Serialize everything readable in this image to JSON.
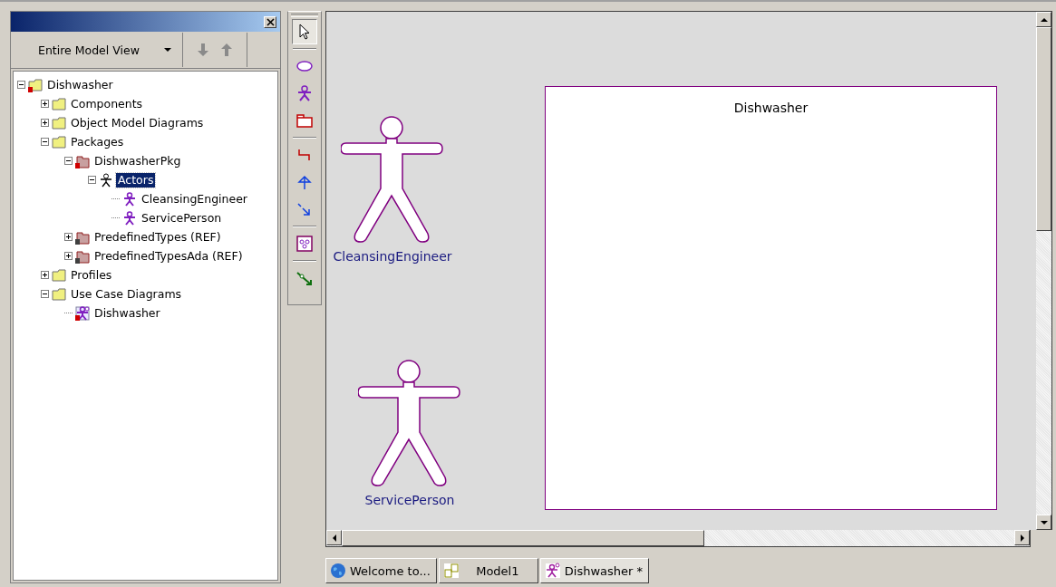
{
  "browser": {
    "view": "Entire Model View",
    "tree": [
      {
        "label": "Dishwasher",
        "kind": "model",
        "expanded": true,
        "selected": false,
        "children": [
          {
            "label": "Components",
            "kind": "folder",
            "expanded": false,
            "selected": false
          },
          {
            "label": "Object Model Diagrams",
            "kind": "folder",
            "expanded": false,
            "selected": false
          },
          {
            "label": "Packages",
            "kind": "folder",
            "expanded": true,
            "selected": false,
            "children": [
              {
                "label": "DishwasherPkg",
                "kind": "package",
                "expanded": true,
                "selected": false,
                "children": [
                  {
                    "label": "Actors",
                    "kind": "actor-group",
                    "expanded": true,
                    "selected": true,
                    "children": [
                      {
                        "label": "CleansingEngineer",
                        "kind": "actor",
                        "selected": false
                      },
                      {
                        "label": "ServicePerson",
                        "kind": "actor",
                        "selected": false
                      }
                    ]
                  }
                ]
              },
              {
                "label": "PredefinedTypes (REF)",
                "kind": "ref-package",
                "expanded": false,
                "selected": false
              },
              {
                "label": "PredefinedTypesAda (REF)",
                "kind": "ref-package",
                "expanded": false,
                "selected": false
              }
            ]
          },
          {
            "label": "Profiles",
            "kind": "folder",
            "expanded": false,
            "selected": false
          },
          {
            "label": "Use Case Diagrams",
            "kind": "folder",
            "expanded": true,
            "selected": false,
            "children": [
              {
                "label": "Dishwasher",
                "kind": "diagram",
                "selected": false
              }
            ]
          }
        ]
      }
    ]
  },
  "tools": [
    [
      {
        "kind": "pointer",
        "selected": true
      }
    ],
    [
      {
        "kind": "usecase",
        "selected": false
      },
      {
        "kind": "actor",
        "selected": false
      },
      {
        "kind": "package",
        "selected": false
      }
    ],
    [
      {
        "kind": "association",
        "selected": false
      },
      {
        "kind": "generalization",
        "selected": false
      },
      {
        "kind": "dependency",
        "selected": false
      }
    ],
    [
      {
        "kind": "diagram",
        "selected": false
      }
    ],
    [
      {
        "kind": "anchor",
        "selected": false
      }
    ]
  ],
  "diagram": {
    "boundary": {
      "title": "Dishwasher"
    },
    "actors": [
      {
        "name": "CleansingEngineer"
      },
      {
        "name": "ServicePerson"
      }
    ]
  },
  "tabs": [
    {
      "label": "Welcome to...",
      "kind": "globe",
      "selected": false
    },
    {
      "label": "Model1",
      "kind": "model",
      "selected": false
    },
    {
      "label": "Dishwasher *",
      "kind": "diagram",
      "selected": true
    }
  ]
}
